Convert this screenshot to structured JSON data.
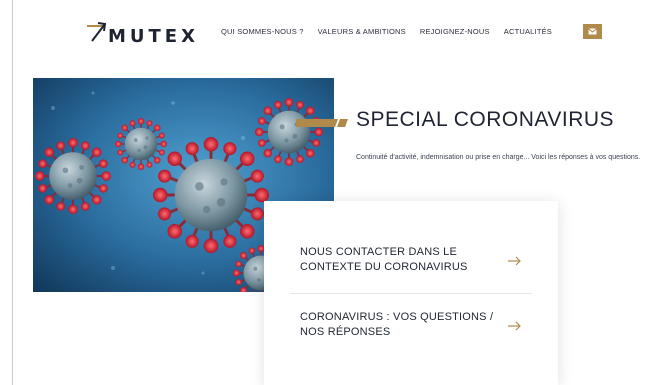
{
  "header": {
    "logo_text": "MUTEX",
    "nav": [
      "QUI SOMMES-NOUS ?",
      "VALEURS & AMBITIONS",
      "REJOIGNEZ-NOUS",
      "ACTUALITÉS"
    ]
  },
  "hero": {
    "title": "SPECIAL CORONAVIRUS",
    "intro": "Continuité d'activité, indemnisation ou prise en charge... Voici les réponses à vos questions."
  },
  "card": {
    "items": [
      "NOUS CONTACTER DANS LE CONTEXTE DU CORONAVIRUS",
      "CORONAVIRUS : VOS QUESTIONS / NOS RÉPONSES"
    ]
  },
  "colors": {
    "accent": "#b08a4a",
    "text_dark": "#1f2433",
    "image_blue": "#2a6c9e"
  },
  "icons": {
    "logo_mark": "arrow-logo-icon",
    "mail": "mail-icon",
    "arrow": "arrow-right-icon"
  }
}
